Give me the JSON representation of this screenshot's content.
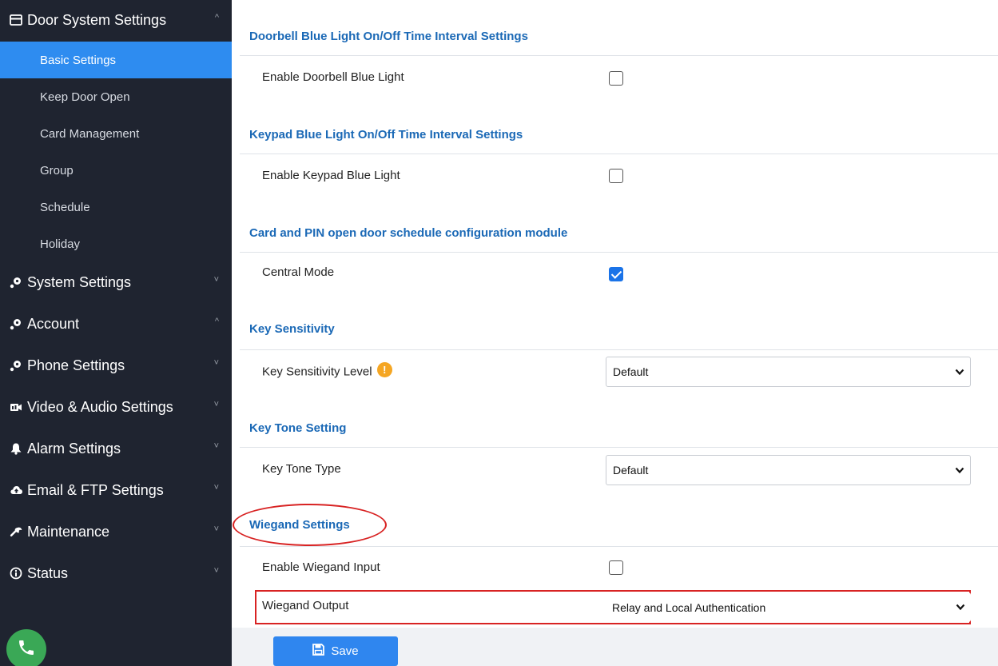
{
  "sidebar": {
    "groups": [
      {
        "label": "Door System Settings",
        "icon": "card-reader-icon",
        "chevron": "^"
      },
      {
        "label": "System Settings",
        "icon": "settings-node-icon",
        "chevron": "˅"
      },
      {
        "label": "Account",
        "icon": "settings-node-icon",
        "chevron": "^"
      },
      {
        "label": "Phone Settings",
        "icon": "settings-node-icon",
        "chevron": "˅"
      },
      {
        "label": "Video & Audio Settings",
        "icon": "video-audio-icon",
        "chevron": "˅"
      },
      {
        "label": "Alarm Settings",
        "icon": "bell-icon",
        "chevron": "˅"
      },
      {
        "label": "Email & FTP Settings",
        "icon": "cloud-upload-icon",
        "chevron": "˅"
      },
      {
        "label": "Maintenance",
        "icon": "wrench-icon",
        "chevron": "˅"
      },
      {
        "label": "Status",
        "icon": "info-circle-icon",
        "chevron": "˅"
      }
    ],
    "door_sub_items": [
      {
        "label": "Basic Settings",
        "active": true
      },
      {
        "label": "Keep Door Open",
        "active": false
      },
      {
        "label": "Card Management",
        "active": false
      },
      {
        "label": "Group",
        "active": false
      },
      {
        "label": "Schedule",
        "active": false
      },
      {
        "label": "Holiday",
        "active": false
      }
    ],
    "phone_icon": "phone-icon"
  },
  "sections": {
    "doorbell": {
      "title": "Doorbell Blue Light On/Off Time Interval Settings",
      "enable_label": "Enable Doorbell Blue Light",
      "checked": false
    },
    "keypad": {
      "title": "Keypad Blue Light On/Off Time Interval Settings",
      "enable_label": "Enable Keypad Blue Light",
      "checked": false
    },
    "card_pin": {
      "title": "Card and PIN open door schedule configuration module",
      "central_label": "Central Mode",
      "checked": true
    },
    "key_sensitivity": {
      "title": "Key Sensitivity",
      "level_label": "Key Sensitivity Level",
      "level_value": "Default",
      "info_icon": "!"
    },
    "key_tone": {
      "title": "Key Tone Setting",
      "type_label": "Key Tone Type",
      "type_value": "Default"
    },
    "wiegand": {
      "title": "Wiegand Settings",
      "input_label": "Enable Wiegand Input",
      "input_checked": false,
      "output_label": "Wiegand Output",
      "output_value": "Relay and Local Authentication"
    }
  },
  "footer": {
    "save_label": "Save"
  },
  "colors": {
    "sidebar_bg": "#1f2430",
    "active_item": "#2e8cf0",
    "section_title": "#1b69b6",
    "annotation_red": "#d82323",
    "save_button": "#2f86ef"
  }
}
